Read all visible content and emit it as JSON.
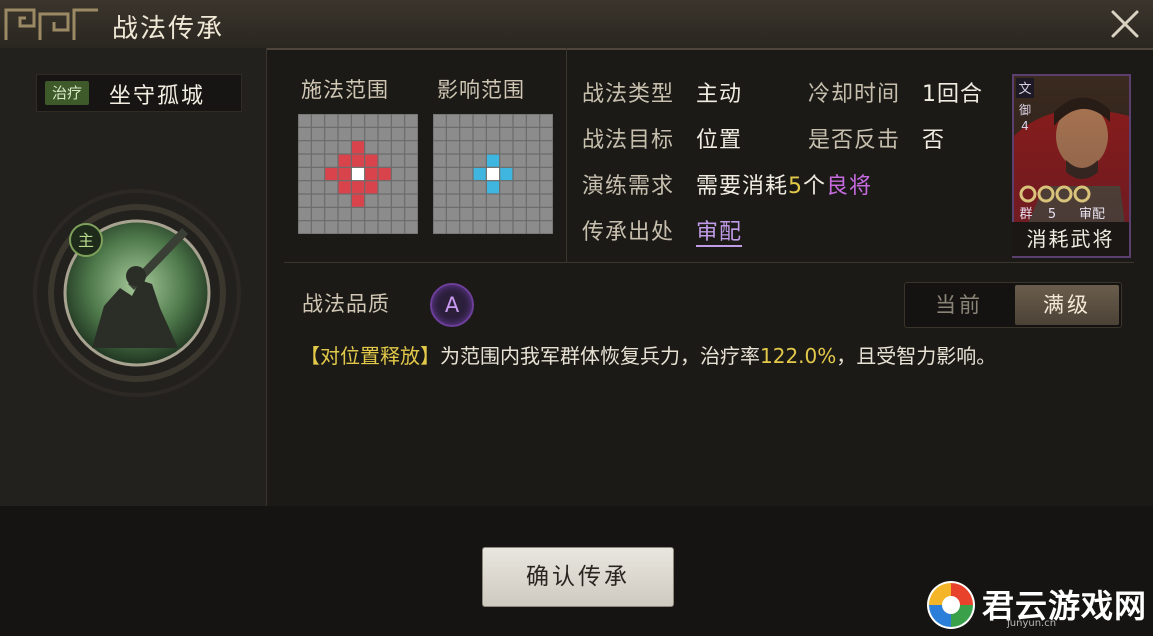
{
  "window": {
    "title": "战法传承"
  },
  "skill": {
    "type_tag": "治疗",
    "name": "坐守孤城",
    "icon_badge": "主"
  },
  "ranges": {
    "cast_label": "施法范围",
    "effect_label": "影响范围",
    "cast_color": "#d9434b",
    "effect_color": "#3fb6e0"
  },
  "info": {
    "type_label": "战法类型",
    "type_value": "主动",
    "cooldown_label": "冷却时间",
    "cooldown_value": "1回合",
    "target_label": "战法目标",
    "target_value": "位置",
    "counter_label": "是否反击",
    "counter_value": "否",
    "req_label": "演练需求",
    "req_prefix": "需要消耗",
    "req_count": "5",
    "req_mid": "个",
    "req_rank": "良将",
    "source_label": "传承出处",
    "source_value": "审配"
  },
  "card": {
    "top_tag": "文",
    "sub_tag": "御",
    "sub_num": "4",
    "faction": "群",
    "cost": "5",
    "name": "审配",
    "footer": "消耗武将"
  },
  "quality": {
    "label": "战法品质",
    "grade": "A"
  },
  "toggle": {
    "current": "当前",
    "max": "满级"
  },
  "description": {
    "tag": "【对位置释放】",
    "part1": "为范围内我军群体恢复兵力，治疗率",
    "rate": "122.0%",
    "part2": "，且受智力影响。"
  },
  "actions": {
    "confirm": "确认传承"
  },
  "watermark": {
    "text": "君云游戏网",
    "sub": "junyun.cn"
  }
}
